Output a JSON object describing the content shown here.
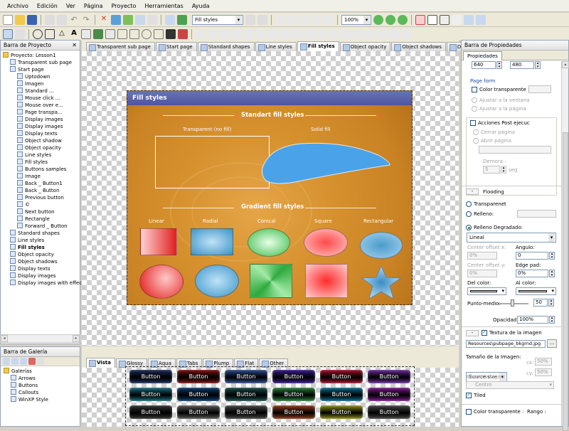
{
  "menu": [
    "Archivo",
    "Edición",
    "Ver",
    "Página",
    "Proyecto",
    "Herramientas",
    "Ayuda"
  ],
  "toolbar": {
    "page_combo": "Fill styles",
    "zoom_combo": "100%"
  },
  "project_panel": {
    "title": "Barra de Proyecto",
    "tree": [
      {
        "label": "Proyecto: Lesson1",
        "level": 0
      },
      {
        "label": "Transparent sub page",
        "level": 1
      },
      {
        "label": "Start page",
        "level": 1
      },
      {
        "label": "Uptodown",
        "level": 2
      },
      {
        "label": "Imagen",
        "level": 2
      },
      {
        "label": "Standard ...",
        "level": 2
      },
      {
        "label": "Mouse click ...",
        "level": 2
      },
      {
        "label": "Mouse over e...",
        "level": 2
      },
      {
        "label": "Page transpa...",
        "level": 2
      },
      {
        "label": "Display images",
        "level": 2
      },
      {
        "label": "Display images",
        "level": 2
      },
      {
        "label": "Display texts",
        "level": 2
      },
      {
        "label": "Object shadow",
        "level": 2
      },
      {
        "label": "Object opacity",
        "level": 2
      },
      {
        "label": "Line styles",
        "level": 2
      },
      {
        "label": "Fill styles",
        "level": 2
      },
      {
        "label": "Buttons samples",
        "level": 2
      },
      {
        "label": "Image",
        "level": 2
      },
      {
        "label": "Back _ Button1",
        "level": 2
      },
      {
        "label": "Back _ Button",
        "level": 2
      },
      {
        "label": "Previous button",
        "level": 2
      },
      {
        "label": "©",
        "level": 2
      },
      {
        "label": "Next button",
        "level": 2
      },
      {
        "label": "Rectangle",
        "level": 2
      },
      {
        "label": "Forward _ Button",
        "level": 2
      },
      {
        "label": "Standard shapes",
        "level": 1
      },
      {
        "label": "Line styles",
        "level": 1
      },
      {
        "label": "Fill styles",
        "level": 1,
        "bold": true
      },
      {
        "label": "Object opacity",
        "level": 1
      },
      {
        "label": "Object shadows",
        "level": 1
      },
      {
        "label": "Display texts",
        "level": 1
      },
      {
        "label": "Display images",
        "level": 1
      },
      {
        "label": "Display images with effects",
        "level": 1
      }
    ]
  },
  "page_tabs": [
    "Transparent sub page",
    "Start page",
    "Standard shapes",
    "Line styles",
    "Fill styles",
    "Object opacity",
    "Object shadows",
    "Display texts"
  ],
  "active_tab": "Fill styles",
  "slide": {
    "title": "Fill styles",
    "standard_heading": "Standart fill styles",
    "transparent_label": "Transparent (no fill)",
    "solid_label": "Solid fill",
    "gradient_heading": "Gradient fill styles",
    "gradient_labels": [
      "Linear",
      "Radial",
      "Conical",
      "Square",
      "Rectangular"
    ]
  },
  "gallery_panel": {
    "title": "Barra de Galería",
    "tree": [
      {
        "label": "Galerías",
        "level": 0
      },
      {
        "label": "Arrows",
        "level": 1
      },
      {
        "label": "Buttons",
        "level": 1
      },
      {
        "label": "Callouts",
        "level": 1
      },
      {
        "label": "WinXP Style",
        "level": 1
      }
    ],
    "tabs": [
      "Vista",
      "Glossy",
      "Aqua",
      "Tabs",
      "Plump",
      "Flat",
      "Other"
    ],
    "active_tab": "Vista",
    "button_label": "Button"
  },
  "props_panel": {
    "title": "Barra de Propiedades",
    "tab": "Propiedades",
    "width": "640",
    "height": "480",
    "page_form": "Page form",
    "transparent_color": "Color transparente :",
    "fit_window": "Ajustar a la ventana",
    "fit_page": "Ajustar a la página",
    "post_actions": "Acciones Post ejecuc",
    "close_page": "Cerrar página",
    "open_page": "Abrir página",
    "delay": "Demora :",
    "delay_value": "5",
    "delay_unit": "seg",
    "flooding": "Flooding",
    "transparent": "Transparenet",
    "fill": "Relleno:",
    "gradient_fill": "Relleno Degradado:",
    "gradient_type": "Lineal",
    "center_x": "Center offset x:",
    "center_x_val": "0%",
    "angle": "Angulo:",
    "angle_val": "0",
    "center_y": "Center offset y:",
    "center_y_val": "0%",
    "edge_pad": "Edge pad:",
    "edge_pad_val": "0%",
    "from_color": "Del color:",
    "to_color": "Al color:",
    "midpoint": "Punto-medio:",
    "midpoint_val": "50",
    "opacity": "Opacidad:",
    "opacity_val": "100%",
    "image_texture": "Textura de la imagen",
    "texture_path": "Resources\\pubpage_bkgrnd.jpg",
    "image_size": "Tamaño de la Imagen:",
    "image_size_val": "Source size",
    "cx": "cx:",
    "cy": "cy:",
    "pct": "50%",
    "align_image": "Alinear imagen:",
    "align_val": "Centro",
    "tiled": "Tiled",
    "transparent_color2": "Color transparente :",
    "range": "Rango :"
  }
}
